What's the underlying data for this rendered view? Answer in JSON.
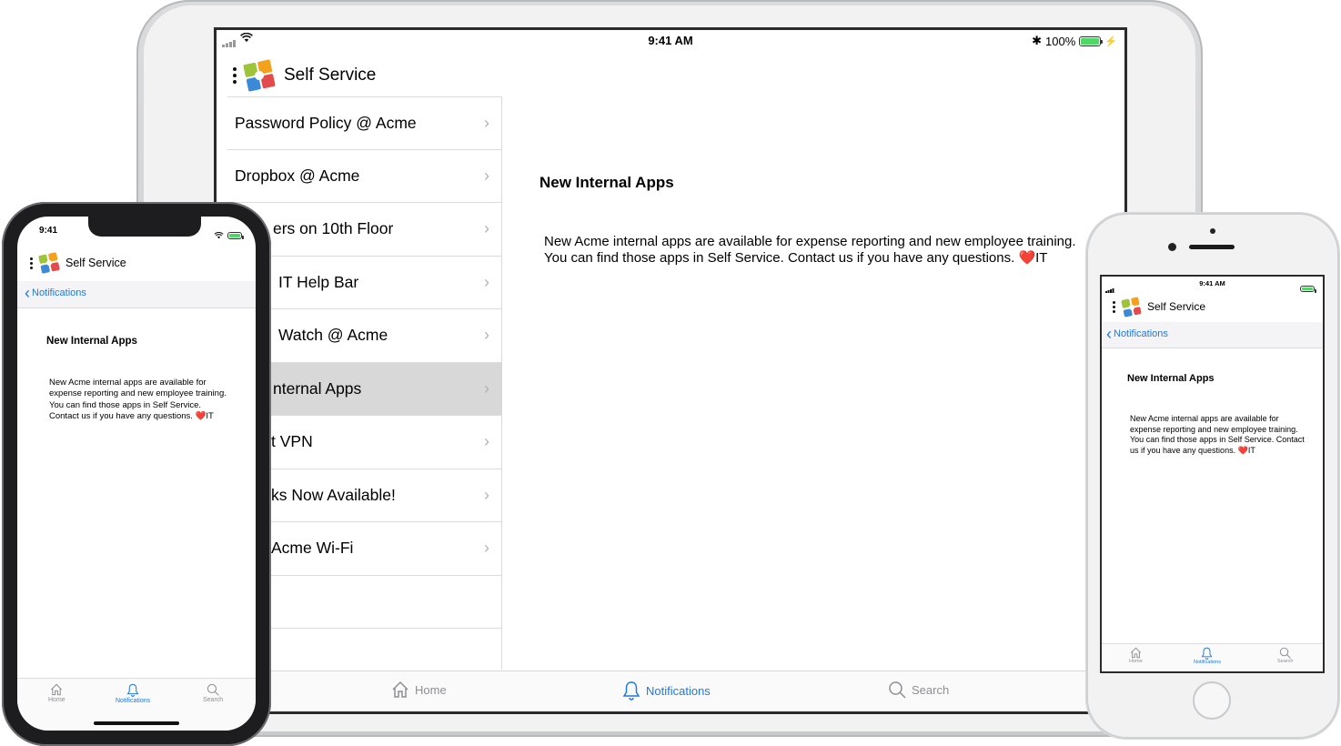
{
  "app": {
    "title": "Self Service",
    "accent_color": "#1e7ae0"
  },
  "status_bar": {
    "ipad_time": "9:41 AM",
    "ipad_battery": "100%",
    "iphone_x_time": "9:41",
    "iphone_8_time": "9:41 AM"
  },
  "notifications_list": [
    {
      "label": "Password Policy @ Acme"
    },
    {
      "label": "Dropbox @ Acme"
    },
    {
      "label": "ers on 10th Floor"
    },
    {
      "label": "IT Help Bar"
    },
    {
      "label": "Watch @ Acme"
    },
    {
      "label": "nternal Apps",
      "selected": true
    },
    {
      "label": "t VPN"
    },
    {
      "label": "ks Now Available!"
    },
    {
      "label": "Acme Wi-Fi"
    }
  ],
  "detail": {
    "title": "New Internal Apps",
    "body": "New Acme internal apps are available for expense reporting and new employee training. You can find those apps in Self Service. Contact us if you have any questions.",
    "signature": "IT",
    "heart": "❤️"
  },
  "nav": {
    "back_label": "Notifications"
  },
  "tabs": {
    "home": "Home",
    "notifications": "Notifications",
    "search": "Search",
    "active": "notifications"
  },
  "icons": {
    "list_chevron": "›",
    "back_chevron": "‹"
  }
}
